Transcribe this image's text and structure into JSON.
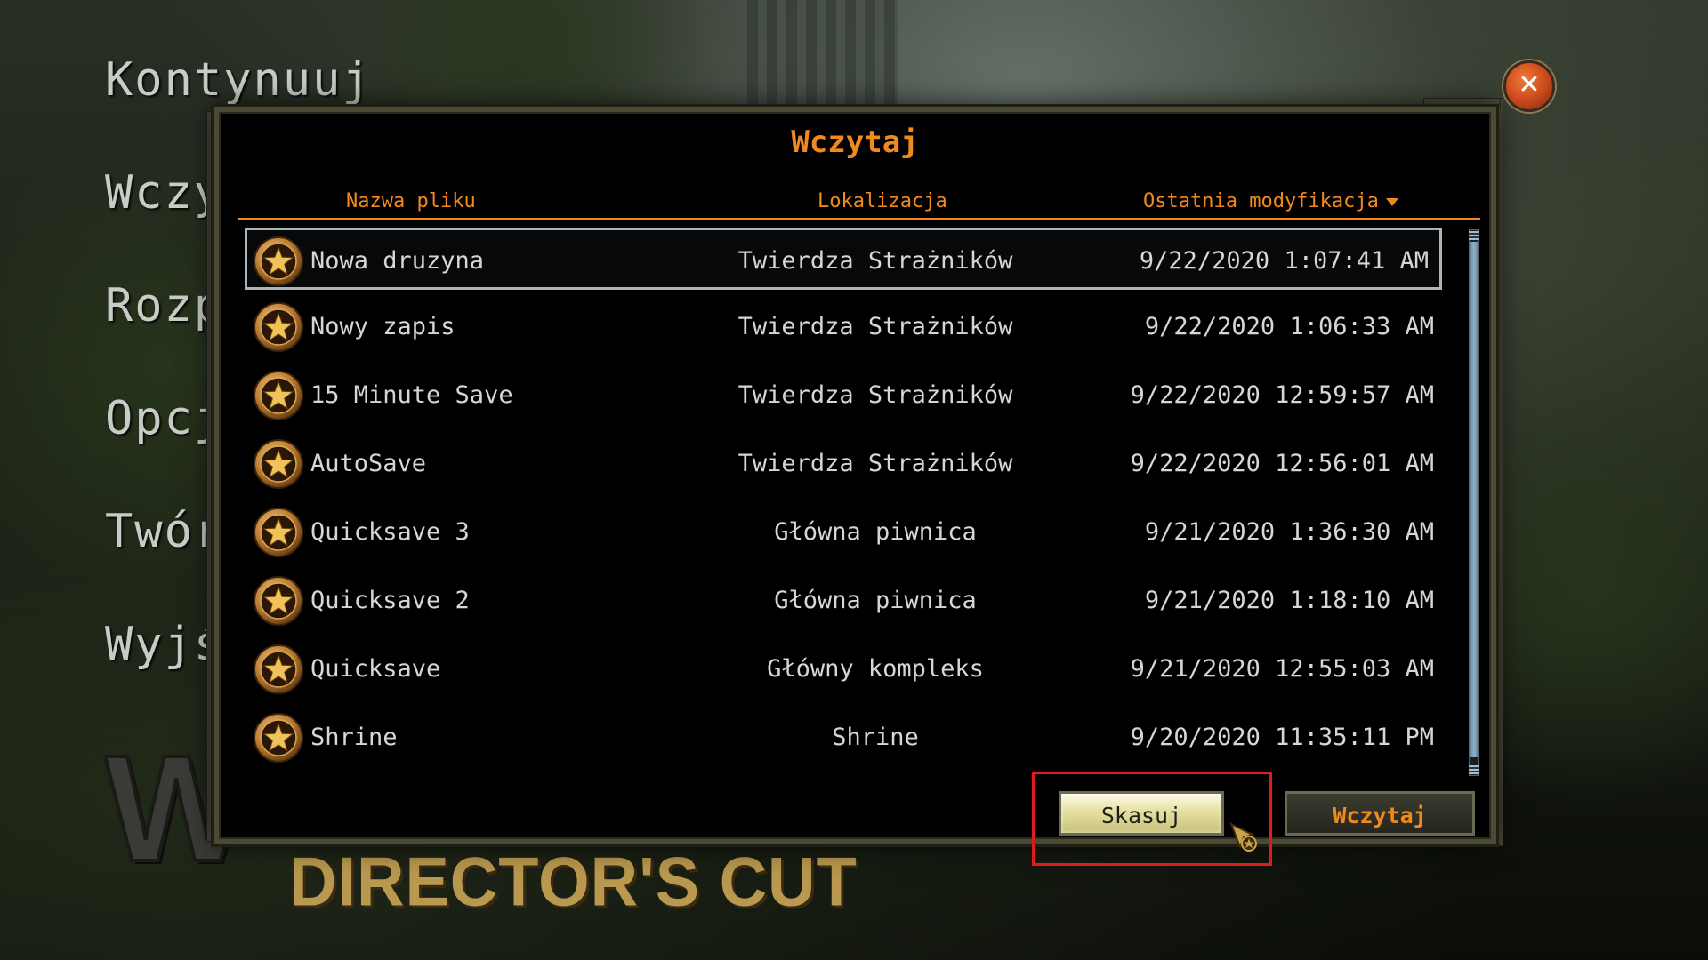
{
  "menu": {
    "items": [
      {
        "label": "Kontynuuj"
      },
      {
        "label": "Wczy"
      },
      {
        "label": "Rozp"
      },
      {
        "label": "Opcj"
      },
      {
        "label": "Twór"
      },
      {
        "label": "Wyjś"
      }
    ]
  },
  "logo": {
    "main_text": "W",
    "subtitle": "DIRECTOR'S CUT"
  },
  "dialog": {
    "title": "Wczytaj",
    "columns": {
      "name": "Nazwa pliku",
      "location": "Lokalizacja",
      "modified": "Ostatnia modyfikacja"
    },
    "sort": {
      "column": "modified",
      "direction": "descending"
    },
    "selected_index": 0,
    "saves": [
      {
        "name": "Nowa druzyna",
        "location": "Twierdza Strażników",
        "modified": "9/22/2020 1:07:41 AM"
      },
      {
        "name": "Nowy zapis",
        "location": "Twierdza Strażników",
        "modified": "9/22/2020 1:06:33 AM"
      },
      {
        "name": "15 Minute Save",
        "location": "Twierdza Strażników",
        "modified": "9/22/2020 12:59:57 AM"
      },
      {
        "name": "AutoSave",
        "location": "Twierdza Strażników",
        "modified": "9/22/2020 12:56:01 AM"
      },
      {
        "name": "Quicksave 3",
        "location": "Główna piwnica",
        "modified": "9/21/2020 1:36:30 AM"
      },
      {
        "name": "Quicksave 2",
        "location": "Główna piwnica",
        "modified": "9/21/2020 1:18:10 AM"
      },
      {
        "name": "Quicksave",
        "location": "Główny kompleks",
        "modified": "9/21/2020 12:55:03 AM"
      },
      {
        "name": "Shrine",
        "location": "Shrine",
        "modified": "9/20/2020 11:35:11 PM"
      }
    ],
    "buttons": {
      "delete": "Skasuj",
      "load": "Wczytaj"
    },
    "close_symbol": "✕"
  },
  "colors": {
    "accent": "#f08a1e",
    "row_text": "#d4d7d2",
    "selection_border": "#a9b4bc",
    "highlight": "#e11b1b"
  },
  "icons": {
    "save_badge": "ranger-star-badge-icon",
    "close": "close-icon",
    "sort": "sort-desc-arrow-icon",
    "cursor": "mouse-pointer-icon"
  }
}
